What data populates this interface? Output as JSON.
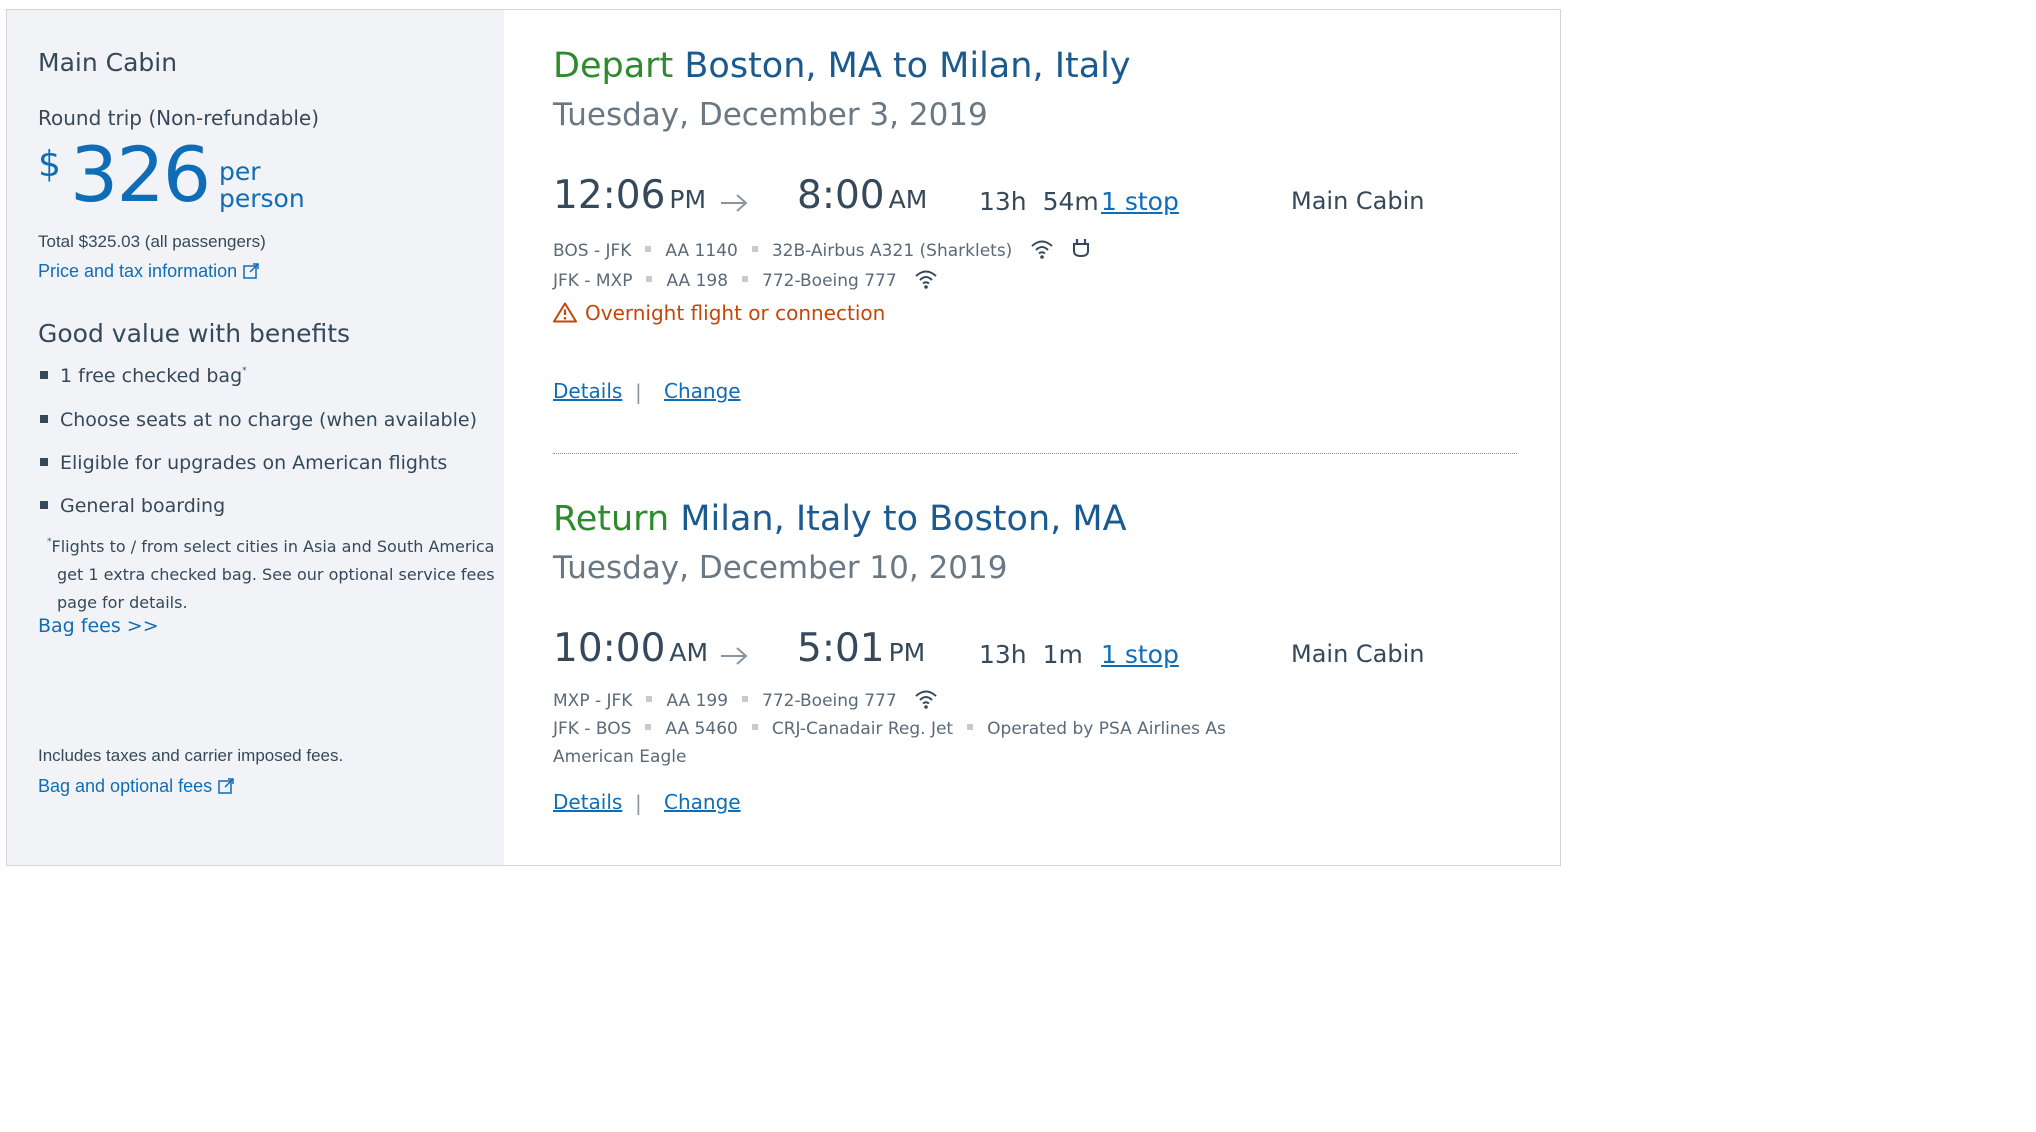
{
  "sidebar": {
    "cabin_title": "Main Cabin",
    "trip_type": "Round trip (Non-refundable)",
    "currency_symbol": "$",
    "price": "326",
    "per_line1": "per",
    "per_line2": "person",
    "total": "Total $325.03 (all passengers)",
    "price_tax_link": "Price and tax information",
    "benefits_title": "Good value with benefits",
    "benefits": [
      "1 free checked bag",
      "Choose seats at no charge (when available)",
      "Eligible for upgrades on American flights",
      "General boarding"
    ],
    "footnote_mark": "*",
    "footnote_line1": "Flights to / from select cities in Asia and South America",
    "footnote_line2": "get 1 extra checked bag. See our optional service fees",
    "footnote_line3": "page for details.",
    "bag_fees_link": "Bag fees >>",
    "includes_text": "Includes taxes and carrier imposed fees.",
    "bag_optional_link": "Bag and optional fees"
  },
  "depart": {
    "direction": "Depart",
    "route": "Boston, MA to Milan, Italy",
    "date": "Tuesday, December 3, 2019",
    "depart_time": "12:06",
    "depart_ampm": "PM",
    "arrive_time": "8:00",
    "arrive_ampm": "AM",
    "duration_h": "13h",
    "duration_m": "54m",
    "stops": "1 stop",
    "cabin": "Main Cabin",
    "segments": [
      {
        "route": "BOS - JFK",
        "flight": "AA 1140",
        "aircraft": "32B-Airbus A321 (Sharklets)"
      },
      {
        "route": "JFK - MXP",
        "flight": "AA 198",
        "aircraft": "772-Boeing 777"
      }
    ],
    "warning": "Overnight flight or connection",
    "details_link": "Details",
    "separator": "|",
    "change_link": "Change"
  },
  "return": {
    "direction": "Return",
    "route": "Milan, Italy to Boston, MA",
    "date": "Tuesday, December 10, 2019",
    "depart_time": "10:00",
    "depart_ampm": "AM",
    "arrive_time": "5:01",
    "arrive_ampm": "PM",
    "duration_h": "13h",
    "duration_m": "1m",
    "stops": "1 stop",
    "cabin": "Main Cabin",
    "segments": [
      {
        "route": "MXP - JFK",
        "flight": "AA 199",
        "aircraft": "772-Boeing 777"
      },
      {
        "route": "JFK - BOS",
        "flight": "AA 5460",
        "aircraft": "CRJ-Canadair Reg. Jet",
        "operated_by_line1": "Operated by PSA Airlines As",
        "operated_by_line2": "American Eagle"
      }
    ],
    "details_link": "Details",
    "separator": "|",
    "change_link": "Change"
  },
  "icons": [
    "external-link-icon",
    "wifi-icon",
    "power-outlet-icon",
    "warning-icon",
    "arrow-right-icon"
  ],
  "colors": {
    "accent_blue": "#0f6db8",
    "depart_green": "#2d8a2d",
    "warning_orange": "#c64508",
    "sidebar_bg": "#f1f3f6"
  }
}
